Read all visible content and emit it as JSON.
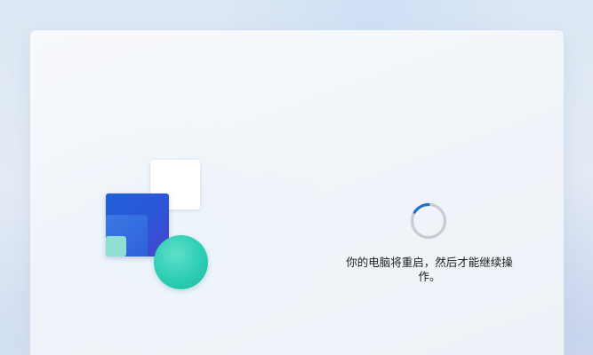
{
  "status": {
    "message": "你的电脑将重启，然后才能继续操作。"
  },
  "spinner": {
    "icon": "loading-spinner-icon",
    "track_color": "#c8ccd2",
    "arc_color": "#1f6fd1"
  },
  "illustration": {
    "icon": "update-illustration",
    "colors": {
      "blue": "#2c56d6",
      "mint": "#8fe0d2",
      "teal": "#2ccdb3",
      "white": "#ffffff"
    }
  }
}
